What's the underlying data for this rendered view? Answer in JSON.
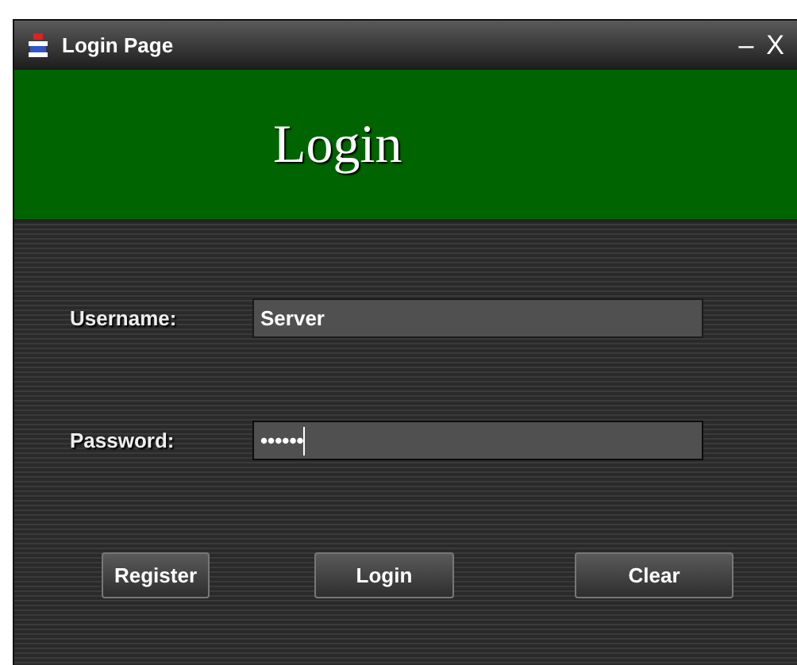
{
  "window": {
    "title": "Login Page",
    "controls": [
      "–",
      "X"
    ]
  },
  "header": {
    "title": "Login"
  },
  "fields": [
    {
      "label": "Username:",
      "value": "Server",
      "focused": false
    },
    {
      "label": "Password:",
      "value": "••••••",
      "focused": true
    }
  ],
  "buttons": [
    "Register",
    "Login",
    "Clear"
  ]
}
